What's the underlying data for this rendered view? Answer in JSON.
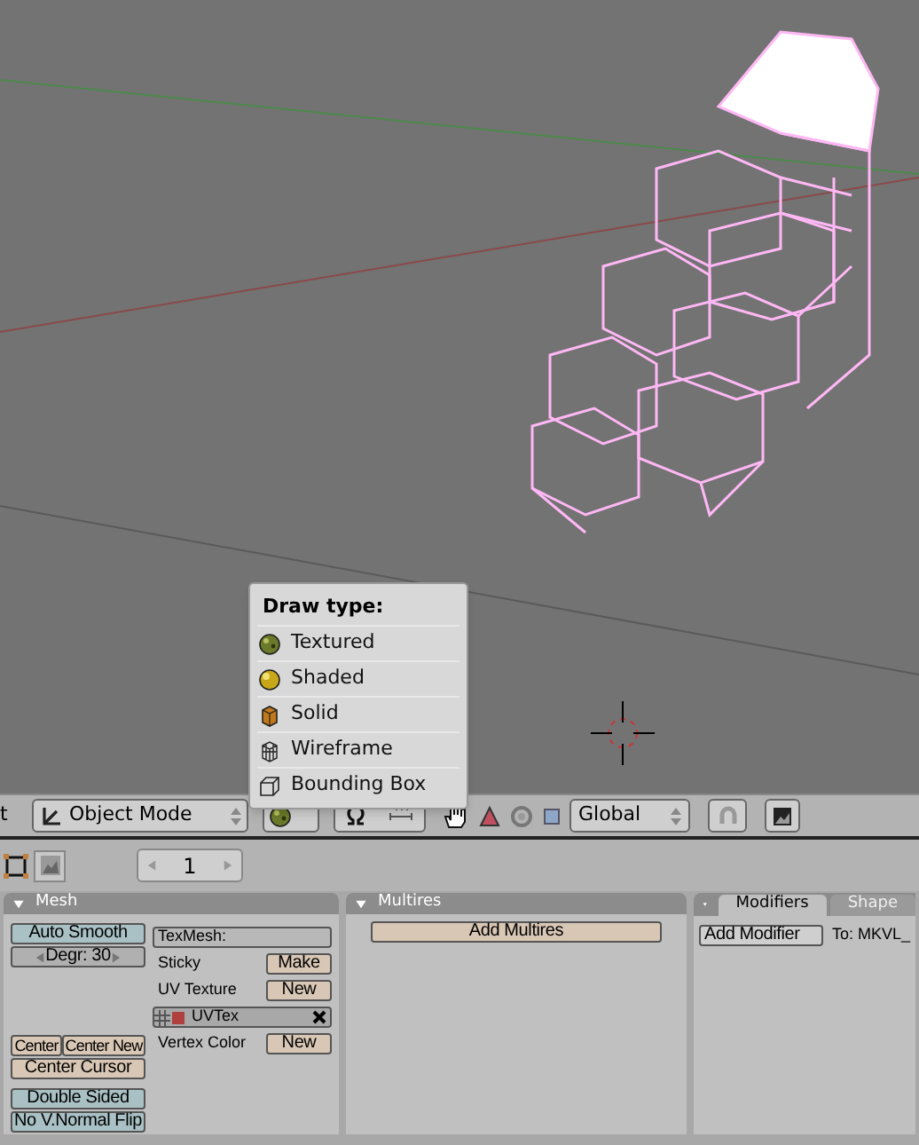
{
  "menu_fragment": "t",
  "mode_select": {
    "value": "Object Mode"
  },
  "draw_type_menu": {
    "title": "Draw type:",
    "items": [
      {
        "label": "Textured",
        "kind": "textured"
      },
      {
        "label": "Shaded",
        "kind": "shaded"
      },
      {
        "label": "Solid",
        "kind": "solid"
      },
      {
        "label": "Wireframe",
        "kind": "wireframe"
      },
      {
        "label": "Bounding Box",
        "kind": "bounding_box"
      }
    ]
  },
  "orientation_select": {
    "value": "Global"
  },
  "frame_field": {
    "value": "1"
  },
  "mesh_panel": {
    "title": "Mesh",
    "auto_smooth": "Auto Smooth",
    "degree_field": "Degr: 30",
    "center_buttons": [
      "Center",
      "Center New"
    ],
    "center_cursor": "Center Cursor",
    "double_sided": "Double Sided",
    "normal_flip": "No V.Normal Flip",
    "texmesh_field": "TexMesh:",
    "sticky": {
      "label": "Sticky",
      "button": "Make"
    },
    "uv_texture": {
      "label": "UV Texture",
      "button": "New"
    },
    "uv_layer": "UVTex",
    "vertex_color": {
      "label": "Vertex Color",
      "button": "New"
    }
  },
  "multires_panel": {
    "title": "Multires",
    "button": "Add Multires"
  },
  "modifiers_panel": {
    "tabs": [
      {
        "label": "Modifiers",
        "selected": true
      },
      {
        "label": "Shape",
        "selected": false
      }
    ],
    "button": "Add Modifier",
    "target": "To: MKVL_"
  }
}
